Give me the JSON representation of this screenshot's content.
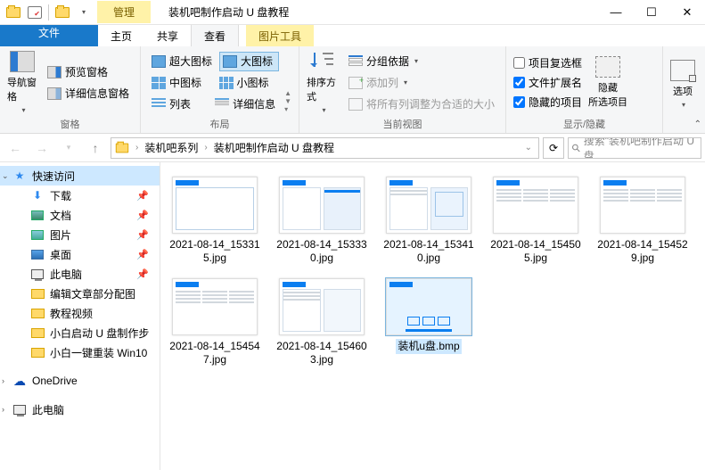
{
  "title": "装机吧制作启动 U 盘教程",
  "manage_tab": "管理",
  "tabs": {
    "file": "文件",
    "home": "主页",
    "share": "共享",
    "view": "查看",
    "pictools": "图片工具"
  },
  "ribbon": {
    "panes": {
      "nav_pane": "导航窗格",
      "preview_pane": "预览窗格",
      "details_pane": "详细信息窗格",
      "label": "窗格"
    },
    "layout": {
      "extra_large": "超大图标",
      "large": "大图标",
      "medium": "中图标",
      "small": "小图标",
      "list": "列表",
      "details": "详细信息",
      "label": "布局"
    },
    "current_view": {
      "sort_by": "排序方式",
      "group_by": "分组依据",
      "add_columns": "添加列",
      "size_columns": "将所有列调整为合适的大小",
      "label": "当前视图"
    },
    "show_hide": {
      "item_checkboxes": "项目复选框",
      "file_ext": "文件扩展名",
      "hidden_items": "隐藏的项目",
      "hide": "隐藏\n所选项目",
      "hide_l1": "隐藏",
      "hide_l2": "所选项目",
      "label": "显示/隐藏"
    },
    "options": "选项"
  },
  "breadcrumb": {
    "a": "装机吧系列",
    "b": "装机吧制作启动 U 盘教程"
  },
  "search_placeholder": "搜索\"装机吧制作启动 U 盘",
  "nav": {
    "quick": "快速访问",
    "downloads": "下载",
    "documents": "文档",
    "pictures": "图片",
    "desktop": "桌面",
    "this_pc": "此电脑",
    "f1": "编辑文章部分配图",
    "f2": "教程视频",
    "f3": "小白启动 U 盘制作步",
    "f4": "小白一键重装 Win10",
    "onedrive": "OneDrive",
    "this_pc2": "此电脑"
  },
  "files": [
    {
      "name": "2021-08-14_153315.jpg",
      "kind": "img1",
      "selected": false
    },
    {
      "name": "2021-08-14_153330.jpg",
      "kind": "img2",
      "selected": false
    },
    {
      "name": "2021-08-14_153410.jpg",
      "kind": "img3",
      "selected": false
    },
    {
      "name": "2021-08-14_154505.jpg",
      "kind": "img4",
      "selected": false
    },
    {
      "name": "2021-08-14_154529.jpg",
      "kind": "img4",
      "selected": false
    },
    {
      "name": "2021-08-14_154547.jpg",
      "kind": "img4",
      "selected": false
    },
    {
      "name": "2021-08-14_154603.jpg",
      "kind": "img5",
      "selected": false
    },
    {
      "name": "装机u盘.bmp",
      "kind": "img6",
      "selected": true
    }
  ]
}
